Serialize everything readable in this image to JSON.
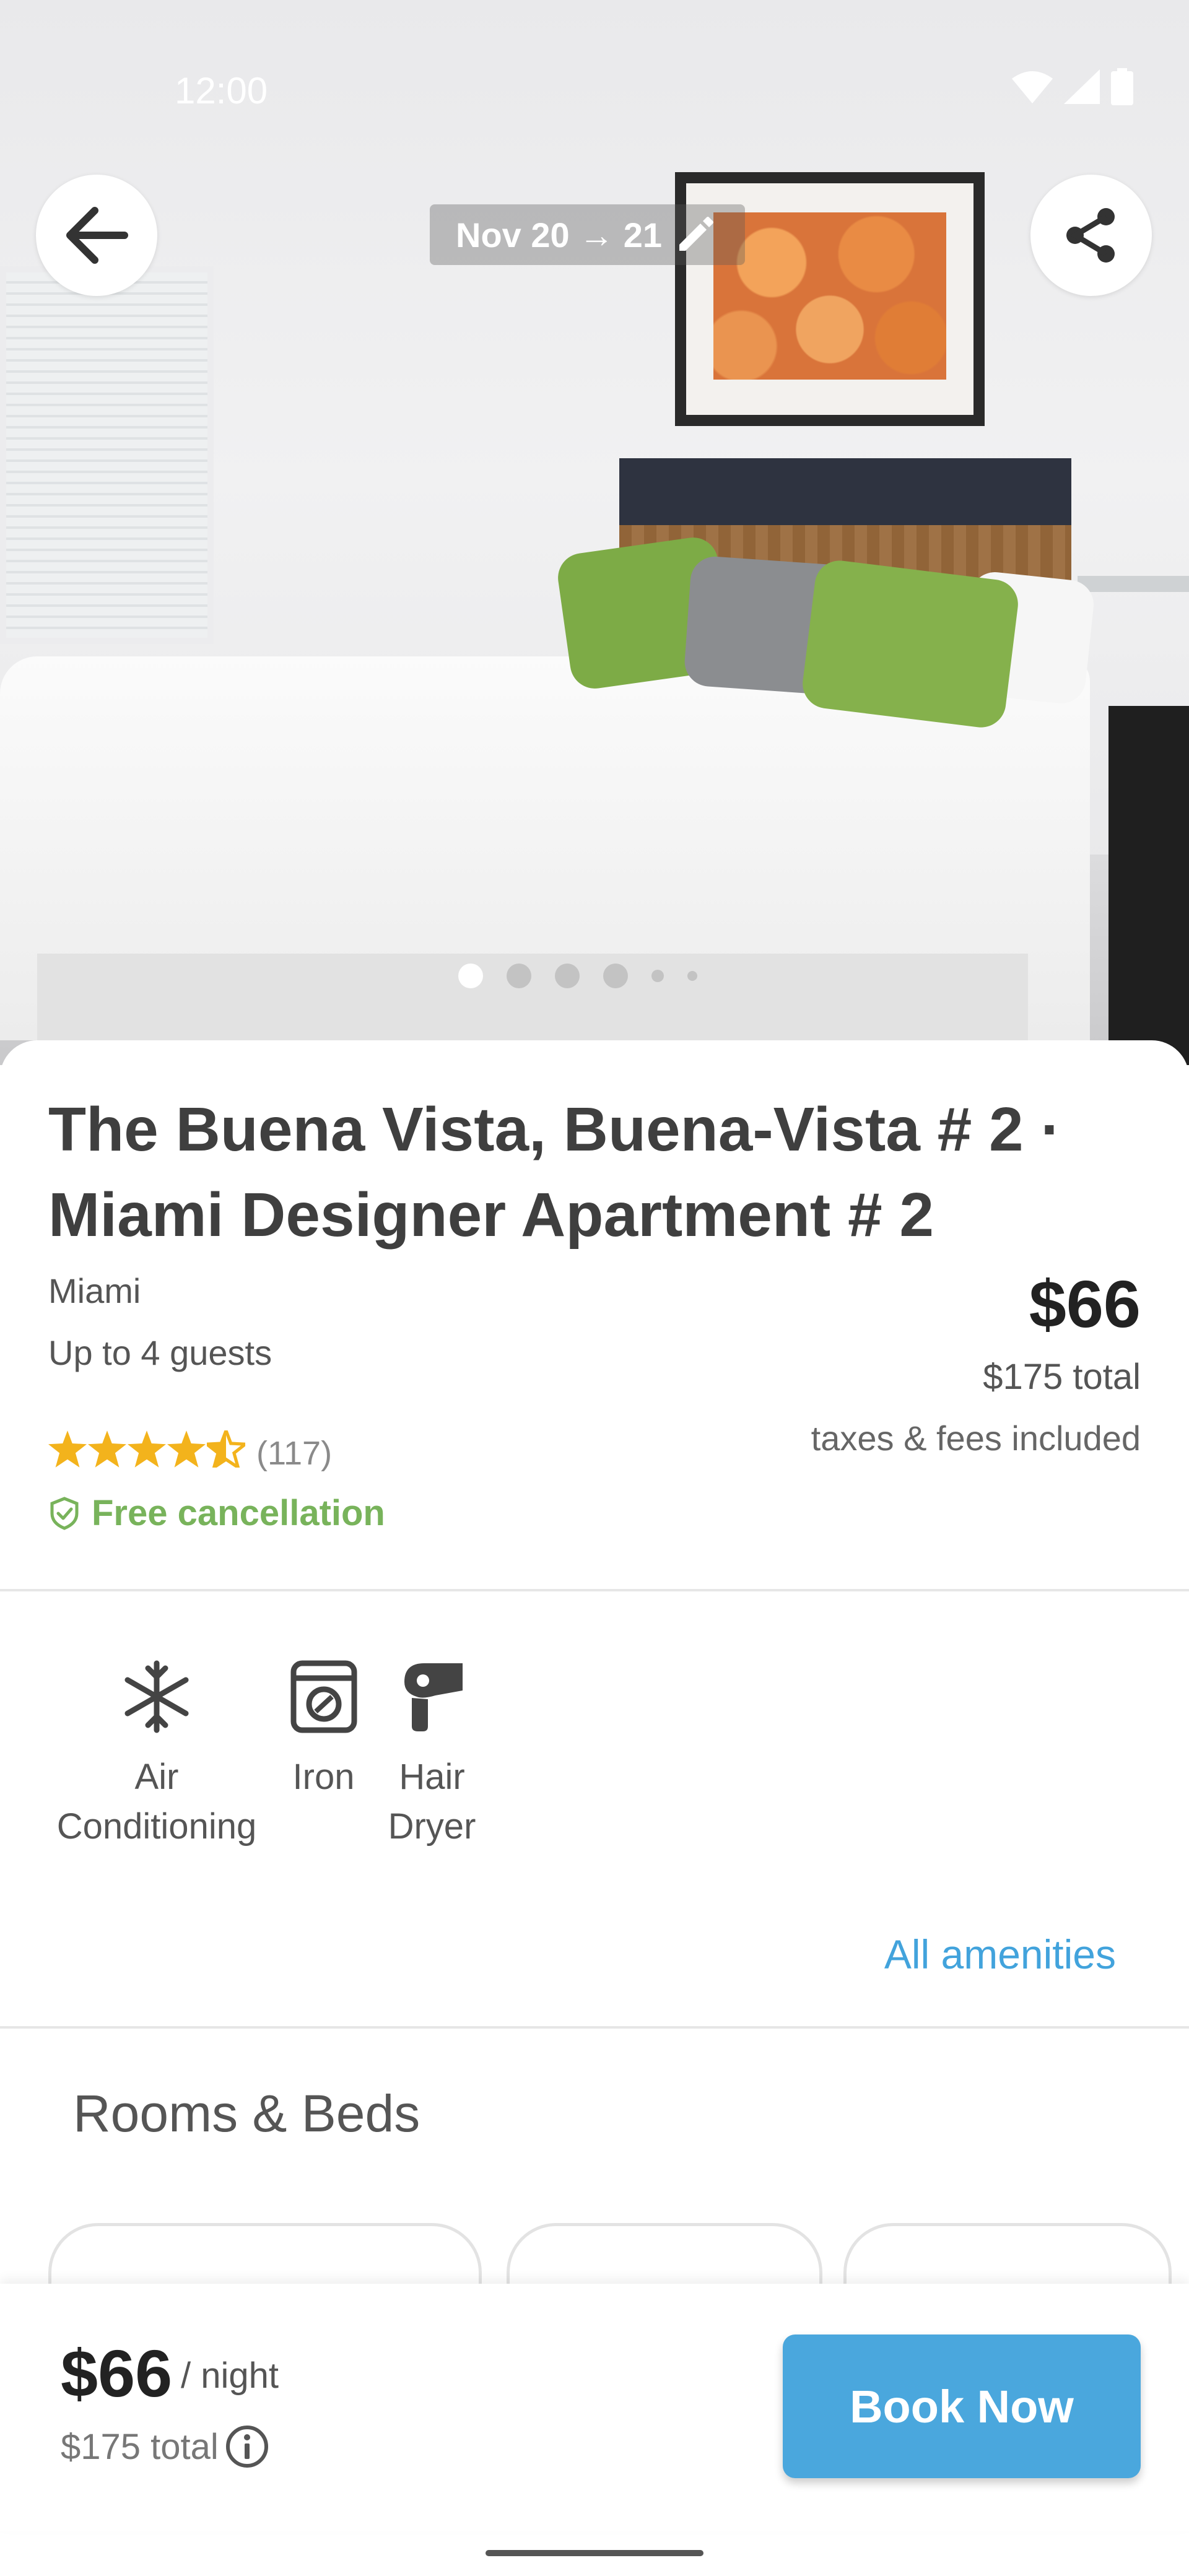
{
  "status_bar": {
    "time": "12:00"
  },
  "top": {
    "date_range": "Nov 20 → 21",
    "back_icon": "arrow-left-icon",
    "share_icon": "share-icon",
    "edit_icon": "pencil-icon"
  },
  "gallery": {
    "photo_count_dots": 6,
    "active_index": 0
  },
  "listing": {
    "title": "The Buena Vista, Buena-Vista # 2 · Miami Designer Apartment # 2",
    "location": "Miami",
    "guests": "Up to 4 guests",
    "price": "$66",
    "total": "$175 total",
    "taxes": "taxes & fees included",
    "rating_stars": 4.5,
    "review_count": "(117)",
    "free_cancellation": "Free cancellation"
  },
  "amenities": {
    "items": [
      {
        "label": "Air Conditioning",
        "icon": "snowflake-icon"
      },
      {
        "label": "Iron",
        "icon": "washer-icon"
      },
      {
        "label": "Hair Dryer",
        "icon": "hair-dryer-icon"
      }
    ],
    "all_link": "All amenities"
  },
  "rooms": {
    "title": "Rooms & Beds"
  },
  "bottom_bar": {
    "price": "$66",
    "per_night": "/ night",
    "total": "$175 total",
    "book_label": "Book Now"
  },
  "colors": {
    "accent_blue": "#4aa7dd",
    "link_blue": "#42a3dc",
    "green": "#78b35b",
    "star": "#f3b31c"
  }
}
